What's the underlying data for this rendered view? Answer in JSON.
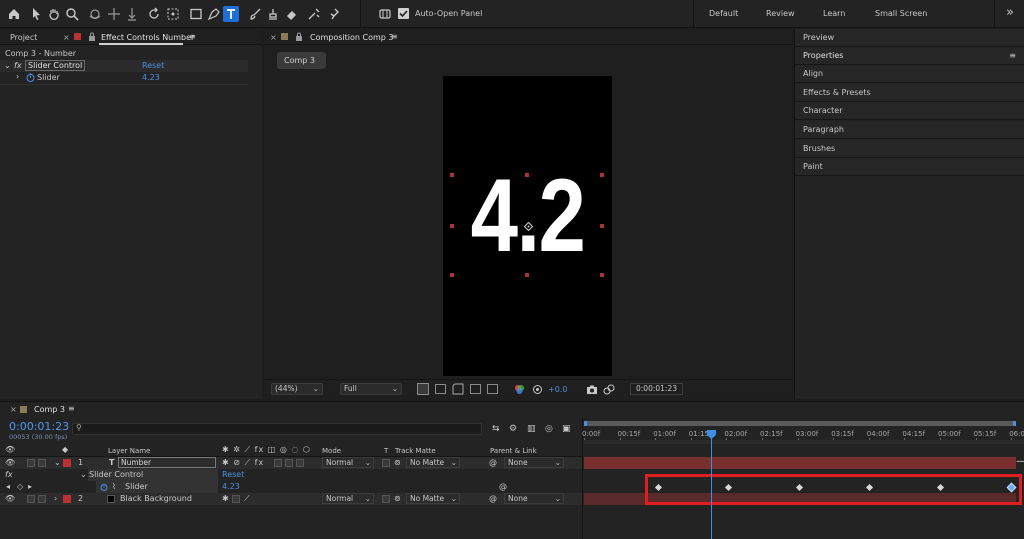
{
  "toolbar": {
    "auto_open_label": "Auto-Open Panel",
    "workspaces": [
      "Default",
      "Review",
      "Learn",
      "Small Screen"
    ],
    "more_glyph": "»"
  },
  "project_panel": {
    "tab_project": "Project",
    "tab_effect_controls": "Effect Controls Number",
    "breadcrumb": "Comp 3 - Number",
    "effect_name": "Slider Control",
    "reset_label": "Reset",
    "property_name": "Slider",
    "property_value": "4.23"
  },
  "composition_panel": {
    "tab_label": "Composition Comp 3",
    "comp_chip": "Comp 3",
    "canvas_text": "4.2",
    "zoom": "(44%)",
    "resolution": "Full",
    "exposure": "+0.0",
    "timecode": "0:00:01:23"
  },
  "right_panels": [
    "Preview",
    "Properties",
    "Align",
    "Effects & Presets",
    "Character",
    "Paragraph",
    "Brushes",
    "Paint"
  ],
  "timeline": {
    "tab_label": "Comp 3",
    "timecode": "0:00:01:23",
    "frame_info": "00053 (30.00 fps)",
    "headers": {
      "layer_name": "Layer Name",
      "mode": "Mode",
      "t": "T",
      "track_matte": "Track Matte",
      "parent_link": "Parent & Link"
    },
    "layers": [
      {
        "num": "1",
        "type_glyph": "T",
        "name": "Number",
        "mode": "Normal",
        "matte": "No Matte",
        "parent": "None"
      },
      {
        "num": "2",
        "type_glyph": "",
        "name": "Black Background",
        "mode": "Normal",
        "matte": "No Matte",
        "parent": "None"
      }
    ],
    "effect_row": {
      "name": "Slider Control",
      "reset": "Reset"
    },
    "slider_row": {
      "name": "Slider",
      "value": "4.23"
    },
    "ruler": [
      "0:00f",
      "00:15f",
      "01:00f",
      "01:15f",
      "02:00f",
      "02:15f",
      "03:00f",
      "03:15f",
      "04:00f",
      "04:15f",
      "05:00f",
      "05:15f",
      "06:0"
    ],
    "keyframe_count": 6
  },
  "colors": {
    "accent_blue": "#3d8ee8",
    "highlight_red": "#e01e1e",
    "layer_bar": "#7a2f2f",
    "label_red": "#b83434"
  }
}
